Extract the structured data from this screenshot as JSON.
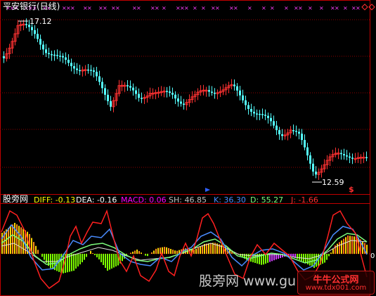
{
  "title": "平安银行(日线)",
  "price_panel": {
    "high_label": "17.12",
    "low_label": "12.59",
    "signal_marker": "$",
    "top_right_icons": [
      "diamond-icon",
      "diamond-icon"
    ]
  },
  "indicator_panel": {
    "name": "股旁网",
    "readouts": [
      {
        "label": "DIFF: -0.13",
        "color": "#ffff00"
      },
      {
        "label": "DEA: -0.16",
        "color": "#ffffff"
      },
      {
        "label": "MACD: 0.06",
        "color": "#ff00ff"
      },
      {
        "label": "SH: 46.85",
        "color": "#c0c0c0"
      },
      {
        "label": "K: 36.30",
        "color": "#4a8cff"
      },
      {
        "label": "D: 55.27",
        "color": "#7cfc7c"
      },
      {
        "label": "J: -1.66",
        "color": "#ff3030"
      }
    ],
    "zero_label": "0"
  },
  "watermark": {
    "text": "股旁网 www.gu",
    "site_cn": "牛牛公式网",
    "site_url": "www.tdx001.com"
  },
  "colors": {
    "up": "#ff3232",
    "down": "#54ffff",
    "grid": "#8b0000",
    "frame": "#c00000"
  }
}
